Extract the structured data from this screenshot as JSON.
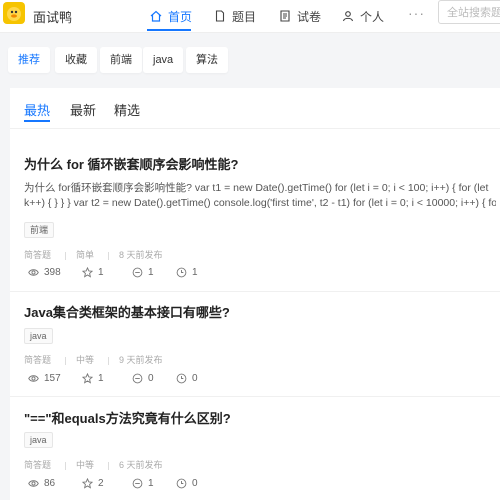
{
  "app": {
    "name": "面试鸭"
  },
  "nav": {
    "items": [
      {
        "label": "首页",
        "icon": "home-icon",
        "active": true
      },
      {
        "label": "题目",
        "icon": "file-icon"
      },
      {
        "label": "试卷",
        "icon": "paper-icon"
      },
      {
        "label": "个人",
        "icon": "user-icon"
      }
    ],
    "more": "···",
    "search_placeholder": "全站搜索题"
  },
  "categories": [
    {
      "label": "推荐",
      "active": true
    },
    {
      "label": "收藏"
    },
    {
      "label": "前端"
    },
    {
      "label": "java"
    },
    {
      "label": "算法"
    }
  ],
  "tabs": [
    {
      "label": "最热",
      "active": true
    },
    {
      "label": "最新"
    },
    {
      "label": "精选"
    }
  ],
  "questions": [
    {
      "title": "为什么 for 循环嵌套顺序会影响性能?",
      "desc_lines": [
        "为什么 for循环嵌套顺序会影响性能?  var t1 = new Date().getTime() for (let i = 0; i < 100; i++) { for (let",
        "k++) { } } } var t2 = new Date().getTime() console.log('first time', t2 - t1) for (let i = 0; i < 10000; i++) { fo"
      ],
      "tag": "前端",
      "meta": [
        "简答题",
        "简单",
        "8 天前发布"
      ],
      "stats": {
        "views": "398",
        "likes": "1",
        "comments": "1",
        "favorites": "1"
      }
    },
    {
      "title": "Java集合类框架的基本接口有哪些?",
      "desc_lines": [],
      "tag": "java",
      "meta": [
        "简答题",
        "中等",
        "9 天前发布"
      ],
      "stats": {
        "views": "157",
        "likes": "1",
        "comments": "0",
        "favorites": "0"
      }
    },
    {
      "title": "\"==\"和equals方法究竟有什么区别?",
      "desc_lines": [],
      "tag": "java",
      "meta": [
        "简答题",
        "中等",
        "6 天前发布"
      ],
      "stats": {
        "views": "86",
        "likes": "2",
        "comments": "1",
        "favorites": "0"
      }
    }
  ],
  "colors": {
    "accent": "#1677ff",
    "logo": "#f6c400"
  }
}
